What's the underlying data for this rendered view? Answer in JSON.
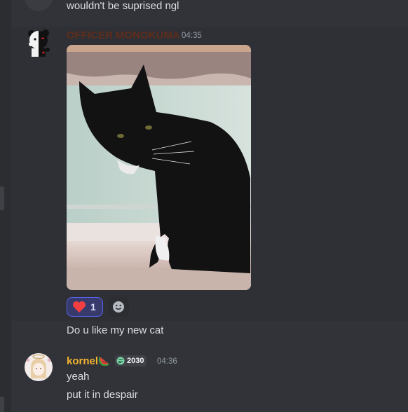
{
  "colors": {
    "background": "#313338",
    "hover_background": "#2e3035",
    "username_officer": "#5e2d1c",
    "username_kornel": "#f0b232",
    "reaction_accent": "#5865f2",
    "heart": "#f23f42"
  },
  "messages": [
    {
      "text": "wouldn't be suprised ngl"
    },
    {
      "username": "OFFICER MONOKUMA",
      "timestamp": "04:35",
      "attachment_icon": "cat-photo",
      "reactions": [
        {
          "icon": "heart-icon",
          "count": "1"
        }
      ],
      "add_reaction_icon": "smile-icon",
      "text": "Do u like my new cat"
    },
    {
      "username": "kornel",
      "username_suffix_icon": "watermelon-icon",
      "badge": {
        "icon": "tag-icon",
        "label": "2030"
      },
      "timestamp": "04:36",
      "lines": [
        "yeah",
        "put it in despair"
      ]
    }
  ]
}
